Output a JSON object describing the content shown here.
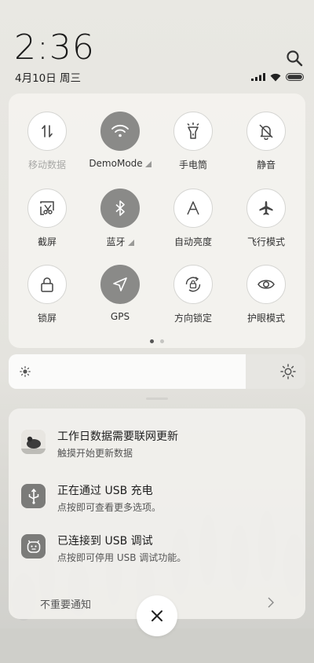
{
  "header": {
    "time": "2:36",
    "date": "4月10日 周三"
  },
  "status_bar": {
    "icons": [
      "signal-icon",
      "wifi-icon",
      "battery-icon"
    ]
  },
  "quick_settings": {
    "tiles": [
      {
        "label": "移动数据",
        "icon": "mobile-data-icon",
        "active": false,
        "dimmed": true
      },
      {
        "label": "DemoMode",
        "icon": "wifi-icon",
        "active": true,
        "has_more": true
      },
      {
        "label": "手电筒",
        "icon": "flashlight-icon",
        "active": false
      },
      {
        "label": "静音",
        "icon": "mute-bell-icon",
        "active": false
      },
      {
        "label": "截屏",
        "icon": "screenshot-icon",
        "active": false
      },
      {
        "label": "蓝牙",
        "icon": "bluetooth-icon",
        "active": true,
        "has_more": true
      },
      {
        "label": "自动亮度",
        "icon": "auto-brightness-icon",
        "active": false
      },
      {
        "label": "飞行模式",
        "icon": "airplane-icon",
        "active": false
      },
      {
        "label": "锁屏",
        "icon": "lock-icon",
        "active": false
      },
      {
        "label": "GPS",
        "icon": "location-icon",
        "active": true
      },
      {
        "label": "方向锁定",
        "icon": "rotation-lock-icon",
        "active": false
      },
      {
        "label": "护眼模式",
        "icon": "eye-icon",
        "active": false
      }
    ],
    "page_count": 2,
    "current_page": 1
  },
  "brightness": {
    "level": 0.8,
    "low_icon": "sun-small-icon",
    "high_icon": "sun-large-icon"
  },
  "notifications": [
    {
      "title": "工作日数据需要联网更新",
      "subtitle": "触摸开始更新数据",
      "icon": "app-thumbnail-icon"
    },
    {
      "title": "正在通过 USB 充电",
      "subtitle": "点按即可查看更多选项。",
      "icon": "usb-icon"
    },
    {
      "title": "已连接到 USB 调试",
      "subtitle": "点按即可停用 USB 调试功能。",
      "icon": "android-debug-icon"
    }
  ],
  "unimportant_label": "不重要通知",
  "colors": {
    "active_tile": "#8a8a88",
    "inactive_tile": "#ffffff",
    "notif_icon_bg": "#7b7b79"
  }
}
